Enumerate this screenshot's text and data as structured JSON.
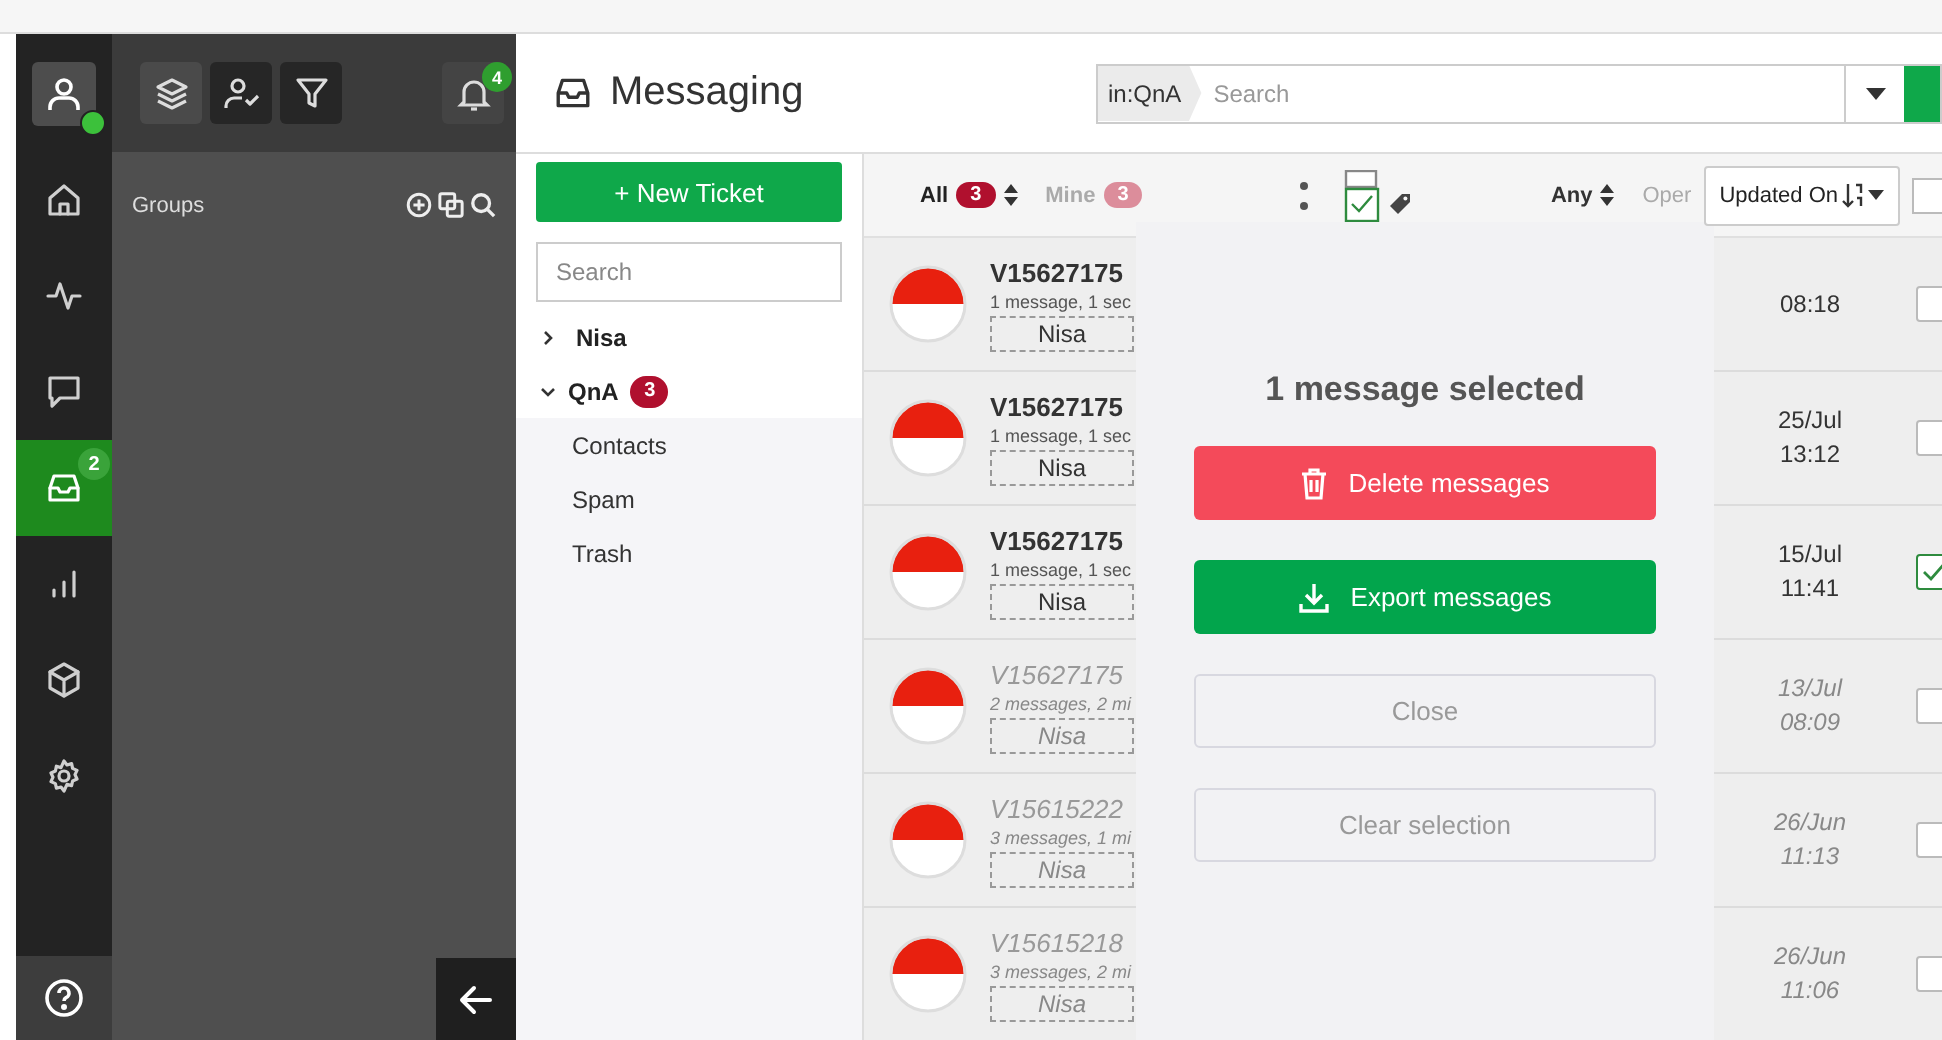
{
  "user": {
    "online": true
  },
  "rail": {
    "items": [
      {
        "kind": "home",
        "selected": false
      },
      {
        "kind": "activity",
        "selected": false
      },
      {
        "kind": "chat",
        "selected": false
      },
      {
        "kind": "inbox",
        "selected": true,
        "badge": "2"
      },
      {
        "kind": "stats",
        "selected": false
      },
      {
        "kind": "package",
        "selected": false
      },
      {
        "kind": "settings",
        "selected": false
      }
    ]
  },
  "panel": {
    "tools": [
      {
        "kind": "layers",
        "selected": false
      },
      {
        "kind": "user-check",
        "selected": true
      },
      {
        "kind": "filter",
        "selected": true
      }
    ],
    "notifications": "4",
    "groups_label": "Groups"
  },
  "header": {
    "title": "Messaging",
    "search": {
      "scope": "in:QnA",
      "placeholder": "Search"
    }
  },
  "folders": {
    "new_ticket": "+ New Ticket",
    "search_placeholder": "Search",
    "tree": [
      {
        "label": "Nisa",
        "expanded": false
      },
      {
        "label": "QnA",
        "expanded": true,
        "badge": "3",
        "children": [
          {
            "label": "Contacts"
          },
          {
            "label": "Spam"
          },
          {
            "label": "Trash"
          }
        ]
      }
    ]
  },
  "toolbar": {
    "filters": [
      {
        "label": "All",
        "count": "3",
        "selected": true
      },
      {
        "label": "Mine",
        "count": "3",
        "selected": false
      }
    ],
    "assignee": "Any",
    "status": "Oper",
    "sort": "Updated On",
    "select_all": {
      "checked": false
    }
  },
  "rows": [
    {
      "title": "V15627175",
      "summary": "1 message, 1 sec",
      "tag": "Nisa",
      "time": "08:18",
      "unread": true,
      "checked": false
    },
    {
      "title": "V15627175",
      "summary": "1 message, 1 sec",
      "tag": "Nisa",
      "time": "25/Jul 13:12",
      "unread": true,
      "checked": false
    },
    {
      "title": "V15627175",
      "summary": "1 message, 1 sec",
      "tag": "Nisa",
      "time": "15/Jul 11:41",
      "unread": true,
      "checked": true
    },
    {
      "title": "V15627175",
      "summary": "2 messages, 2 mi",
      "tag": "Nisa",
      "time": "13/Jul 08:09",
      "unread": false,
      "checked": false
    },
    {
      "title": "V15615222",
      "summary": "3 messages, 1 mi",
      "tag": "Nisa",
      "time": "26/Jun 11:13",
      "unread": false,
      "checked": false
    },
    {
      "title": "V15615218",
      "summary": "3 messages, 2 mi",
      "tag": "Nisa",
      "time": "26/Jun 11:06",
      "unread": false,
      "checked": false
    }
  ],
  "selection": {
    "title": "1 message selected",
    "actions": [
      {
        "kind": "danger",
        "label": "Delete messages"
      },
      {
        "kind": "primary",
        "label": "Export messages"
      },
      {
        "kind": "secondary",
        "label": "Close"
      },
      {
        "kind": "secondary",
        "label": "Clear selection"
      }
    ]
  }
}
